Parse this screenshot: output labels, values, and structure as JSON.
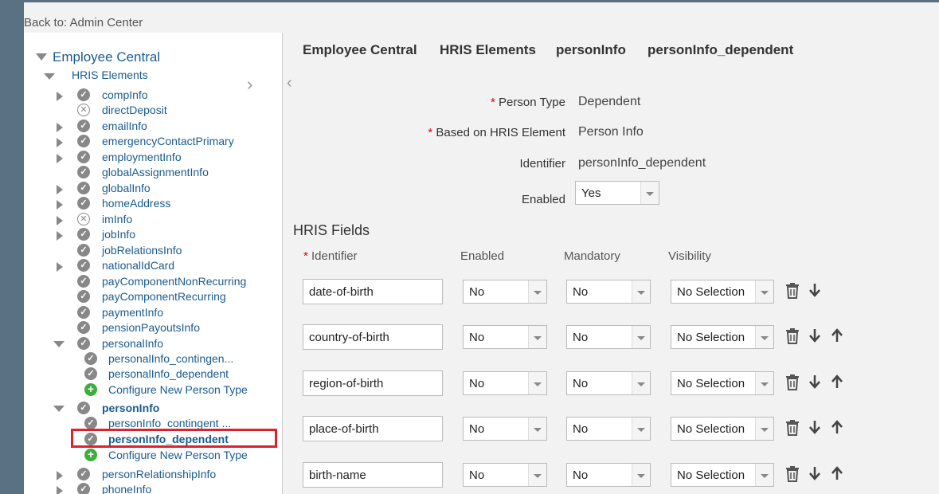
{
  "back_link": "Back to: Admin Center",
  "tree": {
    "root": "Employee Central",
    "group": "HRIS Elements",
    "items": [
      {
        "label": "compInfo",
        "icon": "check",
        "expand": "right"
      },
      {
        "label": "directDeposit",
        "icon": "x",
        "expand": "none"
      },
      {
        "label": "emailInfo",
        "icon": "check",
        "expand": "right"
      },
      {
        "label": "emergencyContactPrimary",
        "icon": "check",
        "expand": "right"
      },
      {
        "label": "employmentInfo",
        "icon": "check",
        "expand": "right"
      },
      {
        "label": "globalAssignmentInfo",
        "icon": "check",
        "expand": "none"
      },
      {
        "label": "globalInfo",
        "icon": "check",
        "expand": "right"
      },
      {
        "label": "homeAddress",
        "icon": "check",
        "expand": "right"
      },
      {
        "label": "imInfo",
        "icon": "x",
        "expand": "right"
      },
      {
        "label": "jobInfo",
        "icon": "check",
        "expand": "right"
      },
      {
        "label": "jobRelationsInfo",
        "icon": "check",
        "expand": "none"
      },
      {
        "label": "nationalIdCard",
        "icon": "check",
        "expand": "right"
      },
      {
        "label": "payComponentNonRecurring",
        "icon": "check",
        "expand": "none"
      },
      {
        "label": "payComponentRecurring",
        "icon": "check",
        "expand": "none"
      },
      {
        "label": "paymentInfo",
        "icon": "check",
        "expand": "none"
      },
      {
        "label": "pensionPayoutsInfo",
        "icon": "check",
        "expand": "none"
      },
      {
        "label": "personalInfo",
        "icon": "check",
        "expand": "down"
      },
      {
        "label": "personalInfo_contingen...",
        "icon": "check",
        "child": true
      },
      {
        "label": "personalInfo_dependent",
        "icon": "check",
        "child": true
      },
      {
        "label": "Configure New Person Type",
        "icon": "plus",
        "child": true
      },
      {
        "label": "personInfo",
        "icon": "check",
        "expand": "down",
        "bold": true
      },
      {
        "label": "personInfo_contingent ...",
        "icon": "check",
        "child": true
      },
      {
        "label": "personInfo_dependent",
        "icon": "check",
        "child": true,
        "bold": true
      },
      {
        "label": "Configure New Person Type",
        "icon": "plus",
        "child": true
      },
      {
        "label": "personRelationshipInfo",
        "icon": "check",
        "expand": "right"
      },
      {
        "label": "phoneInfo",
        "icon": "check",
        "expand": "right"
      }
    ]
  },
  "breadcrumb": [
    "Employee Central",
    "HRIS Elements",
    "personInfo",
    "personInfo_dependent"
  ],
  "form": {
    "person_type_label": "Person Type",
    "person_type_value": "Dependent",
    "based_on_label": "Based on HRIS Element",
    "based_on_value": "Person Info",
    "identifier_label": "Identifier",
    "identifier_value": "personInfo_dependent",
    "enabled_label": "Enabled",
    "enabled_value": "Yes"
  },
  "hris_fields": {
    "title": "HRIS Fields",
    "columns": {
      "identifier": "Identifier",
      "enabled": "Enabled",
      "mandatory": "Mandatory",
      "visibility": "Visibility"
    },
    "rows": [
      {
        "identifier": "date-of-birth",
        "enabled": "No",
        "mandatory": "No",
        "visibility": "No Selection",
        "up": false
      },
      {
        "identifier": "country-of-birth",
        "enabled": "No",
        "mandatory": "No",
        "visibility": "No Selection",
        "up": true
      },
      {
        "identifier": "region-of-birth",
        "enabled": "No",
        "mandatory": "No",
        "visibility": "No Selection",
        "up": true
      },
      {
        "identifier": "place-of-birth",
        "enabled": "No",
        "mandatory": "No",
        "visibility": "No Selection",
        "up": true
      },
      {
        "identifier": "birth-name",
        "enabled": "No",
        "mandatory": "No",
        "visibility": "No Selection",
        "up": true
      }
    ]
  },
  "colors": {
    "accent": "#1a5b8e",
    "highlight": "#e0202a",
    "required": "#dd0000"
  }
}
